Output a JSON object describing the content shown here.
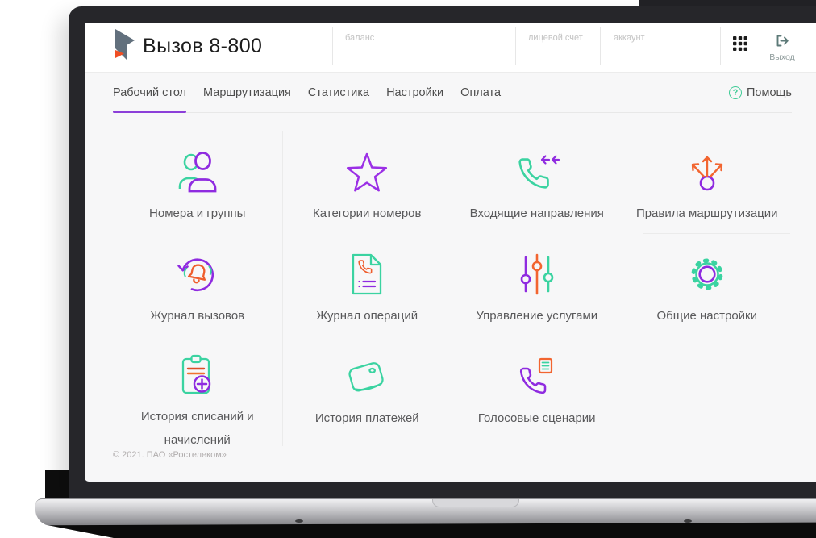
{
  "app": {
    "title": "Вызов 8-800"
  },
  "header": {
    "balance_label": "баланс",
    "personal_account_label": "лицевой счет",
    "account_label": "аккаунт",
    "logout_label": "Выход"
  },
  "nav": {
    "tabs": [
      {
        "label": "Рабочий стол",
        "active": true
      },
      {
        "label": "Маршрутизация",
        "active": false
      },
      {
        "label": "Статистика",
        "active": false
      },
      {
        "label": "Настройки",
        "active": false
      },
      {
        "label": "Оплата",
        "active": false
      }
    ],
    "help_label": "Помощь",
    "help_icon_glyph": "?"
  },
  "tiles": [
    {
      "label": "Номера и группы",
      "icon": "users-icon"
    },
    {
      "label": "Категории номеров",
      "icon": "star-icon"
    },
    {
      "label": "Входящие направления",
      "icon": "incoming-call-icon"
    },
    {
      "label": "Правила маршрутизации",
      "icon": "routing-arrows-icon"
    },
    {
      "label": "Журнал вызовов",
      "icon": "call-log-icon"
    },
    {
      "label": "Журнал операций",
      "icon": "operations-log-icon"
    },
    {
      "label": "Управление услугами",
      "icon": "sliders-icon"
    },
    {
      "label": "Общие настройки",
      "icon": "gear-icon"
    },
    {
      "label": "История списаний и начислений",
      "icon": "clipboard-plus-icon"
    },
    {
      "label": "История платежей",
      "icon": "wallet-icon"
    },
    {
      "label": "Голосовые сценарии",
      "icon": "voice-script-icon"
    }
  ],
  "footer": {
    "copyright": "© 2021. ПАО «Ростелеком»"
  },
  "colors": {
    "accent_purple": "#8f2be0",
    "accent_teal": "#3bd3a1",
    "accent_orange": "#f05f2e",
    "help_green": "#3fcb96",
    "active_tab_underline": "#8c3fd9",
    "logo_slate": "#62707d",
    "logo_orange": "#f04e23"
  }
}
